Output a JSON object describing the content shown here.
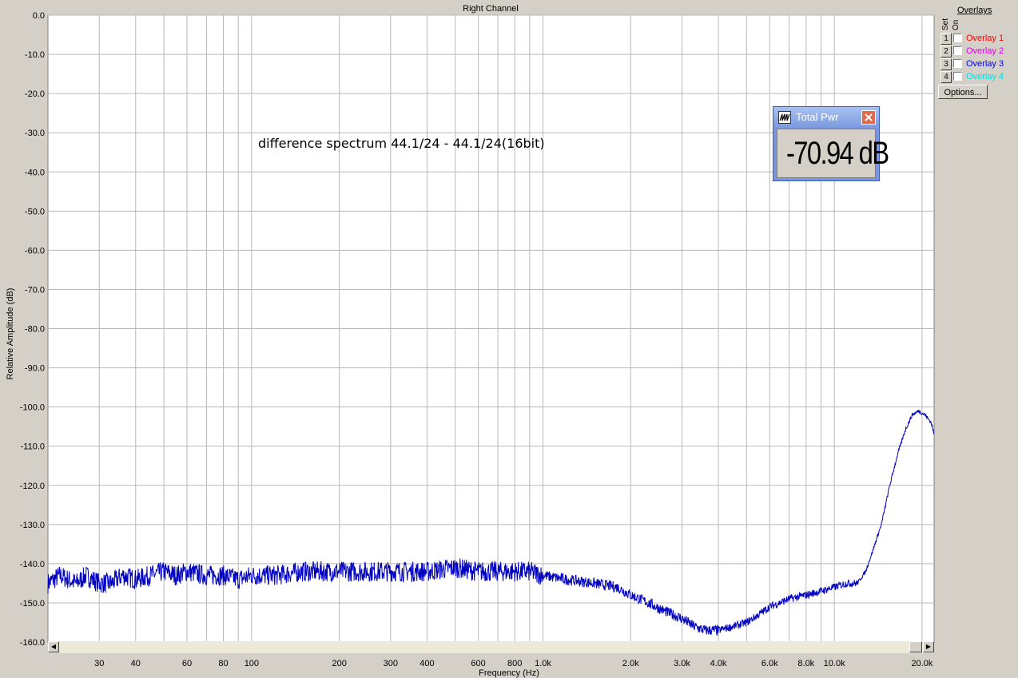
{
  "chart_data": {
    "type": "line",
    "title": "Right Channel",
    "annotation": "difference spectrum 44.1/24 - 44.1/24(16bit)",
    "xlabel": "Frequency (Hz)",
    "ylabel": "Relative Amplitude (dB)",
    "x_scale": "log",
    "xlim": [
      20,
      22000
    ],
    "ylim": [
      -160,
      0
    ],
    "grid": true,
    "y_ticks": [
      0,
      -10,
      -20,
      -30,
      -40,
      -50,
      -60,
      -70,
      -80,
      -90,
      -100,
      -110,
      -120,
      -130,
      -140,
      -150,
      -160
    ],
    "y_tick_labels": [
      "0.0",
      "-10.0",
      "-20.0",
      "-30.0",
      "-40.0",
      "-50.0",
      "-60.0",
      "-70.0",
      "-80.0",
      "-90.0",
      "-100.0",
      "-110.0",
      "-120.0",
      "-130.0",
      "-140.0",
      "-150.0",
      "-160.0"
    ],
    "x_ticks": [
      30,
      40,
      60,
      80,
      100,
      200,
      300,
      400,
      600,
      800,
      1000,
      2000,
      3000,
      4000,
      6000,
      8000,
      10000,
      20000
    ],
    "x_tick_labels": [
      "30",
      "40",
      "60",
      "80",
      "100",
      "200",
      "300",
      "400",
      "600",
      "800",
      "1.0k",
      "2.0k",
      "3.0k",
      "4.0k",
      "6.0k",
      "8.0k",
      "10.0k",
      "20.0k"
    ],
    "series": [
      {
        "color": "#0000c0",
        "x": [
          20,
          22,
          25,
          27,
          30,
          33,
          36,
          40,
          45,
          50,
          55,
          60,
          70,
          80,
          90,
          100,
          120,
          150,
          200,
          250,
          300,
          400,
          500,
          600,
          700,
          800,
          900,
          1000,
          1200,
          1500,
          1800,
          2000,
          2300,
          2600,
          3000,
          3300,
          3600,
          4000,
          4500,
          5000,
          5500,
          6000,
          7000,
          8000,
          9000,
          10000,
          11000,
          12000,
          12800,
          13500,
          14500,
          15500,
          16500,
          17500,
          18500,
          19500,
          20500,
          21500,
          22000
        ],
        "y": [
          -145,
          -143,
          -145,
          -143,
          -145,
          -145,
          -143,
          -144,
          -143,
          -142,
          -143,
          -142,
          -143,
          -143,
          -144,
          -143,
          -143,
          -142,
          -142,
          -142,
          -142,
          -142,
          -141,
          -142,
          -142,
          -142,
          -142,
          -143,
          -144,
          -145,
          -146,
          -148,
          -150,
          -152,
          -154,
          -156,
          -157,
          -157,
          -156,
          -155,
          -153,
          -151,
          -149,
          -148,
          -147,
          -146,
          -145,
          -145,
          -142,
          -137,
          -130,
          -120,
          -112,
          -106,
          -102,
          -101,
          -102,
          -104,
          -107
        ]
      }
    ]
  },
  "overlays": {
    "header": "Overlays",
    "set_label": "Set",
    "on_label": "On",
    "items": [
      {
        "num": "1",
        "label": "Overlay 1",
        "color": "#ff0000"
      },
      {
        "num": "2",
        "label": "Overlay 2",
        "color": "#e000e0"
      },
      {
        "num": "3",
        "label": "Overlay 3",
        "color": "#0000e0"
      },
      {
        "num": "4",
        "label": "Overlay 4",
        "color": "#00e0e0"
      }
    ],
    "options_label": "Options..."
  },
  "total_power": {
    "title": "Total Pwr",
    "value": "-70.94 dB"
  }
}
